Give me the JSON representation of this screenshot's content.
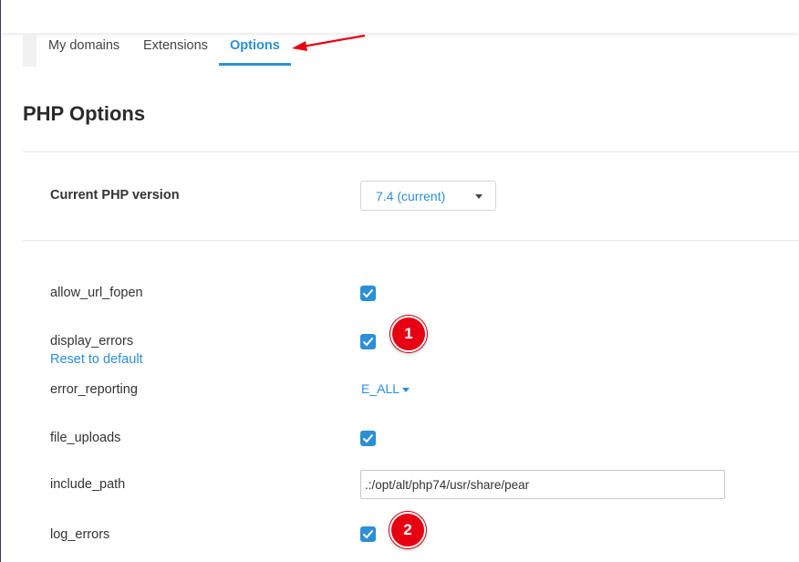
{
  "tabs": [
    {
      "label": "My domains"
    },
    {
      "label": "Extensions"
    },
    {
      "label": "Options",
      "active": true
    }
  ],
  "page_title": "PHP Options",
  "php_version": {
    "label": "Current PHP version",
    "value": "7.4 (current)"
  },
  "options": {
    "allow_url_fopen": {
      "label": "allow_url_fopen",
      "checked": true
    },
    "display_errors": {
      "label": "display_errors",
      "checked": true,
      "reset_label": "Reset to default"
    },
    "error_reporting": {
      "label": "error_reporting",
      "value": "E_ALL"
    },
    "file_uploads": {
      "label": "file_uploads",
      "checked": true
    },
    "include_path": {
      "label": "include_path",
      "value": ".:/opt/alt/php74/usr/share/pear"
    },
    "log_errors": {
      "label": "log_errors",
      "checked": true
    }
  },
  "annotations": {
    "badge_1": "1",
    "badge_2": "2",
    "arrow_color": "#e60012",
    "badge_color": "#e60012"
  },
  "colors": {
    "accent": "#2c8fd8"
  }
}
